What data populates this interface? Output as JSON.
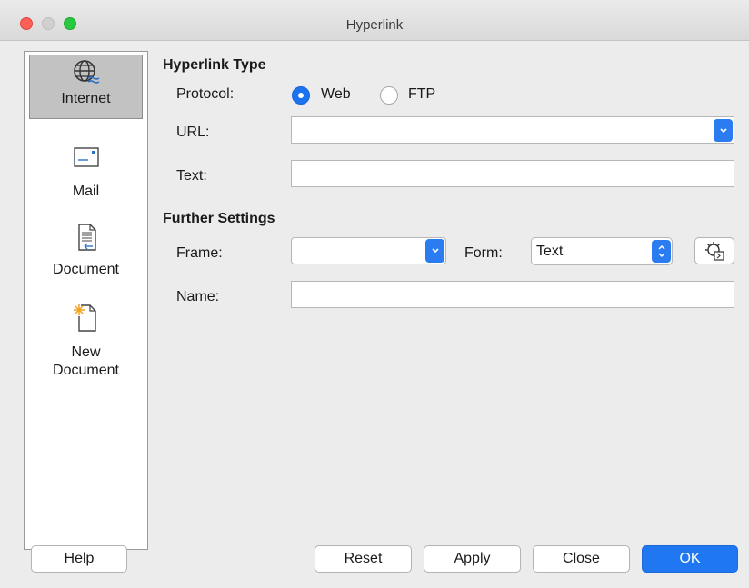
{
  "window": {
    "title": "Hyperlink"
  },
  "sidebar": {
    "items": [
      {
        "label": "Internet",
        "icon": "globe-icon",
        "selected": true
      },
      {
        "label": "Mail",
        "icon": "envelope-icon",
        "selected": false
      },
      {
        "label": "Document",
        "icon": "document-icon",
        "selected": false
      },
      {
        "label": "New",
        "label2": "Document",
        "icon": "new-document-icon",
        "selected": false
      }
    ]
  },
  "hyperlink_type": {
    "title": "Hyperlink Type",
    "protocol_label": "Protocol:",
    "options": [
      {
        "label": "Web",
        "selected": true
      },
      {
        "label": "FTP",
        "selected": false
      }
    ],
    "url_label": "URL:",
    "url_value": "",
    "text_label": "Text:",
    "text_value": ""
  },
  "further_settings": {
    "title": "Further Settings",
    "frame_label": "Frame:",
    "frame_value": "",
    "form_label": "Form:",
    "form_value": "Text",
    "name_label": "Name:",
    "name_value": ""
  },
  "buttons": {
    "help": "Help",
    "reset": "Reset",
    "apply": "Apply",
    "close": "Close",
    "ok": "OK"
  },
  "colors": {
    "accent": "#1f77f2",
    "close_light": "#fe5f57",
    "maximize_light": "#28c840"
  }
}
